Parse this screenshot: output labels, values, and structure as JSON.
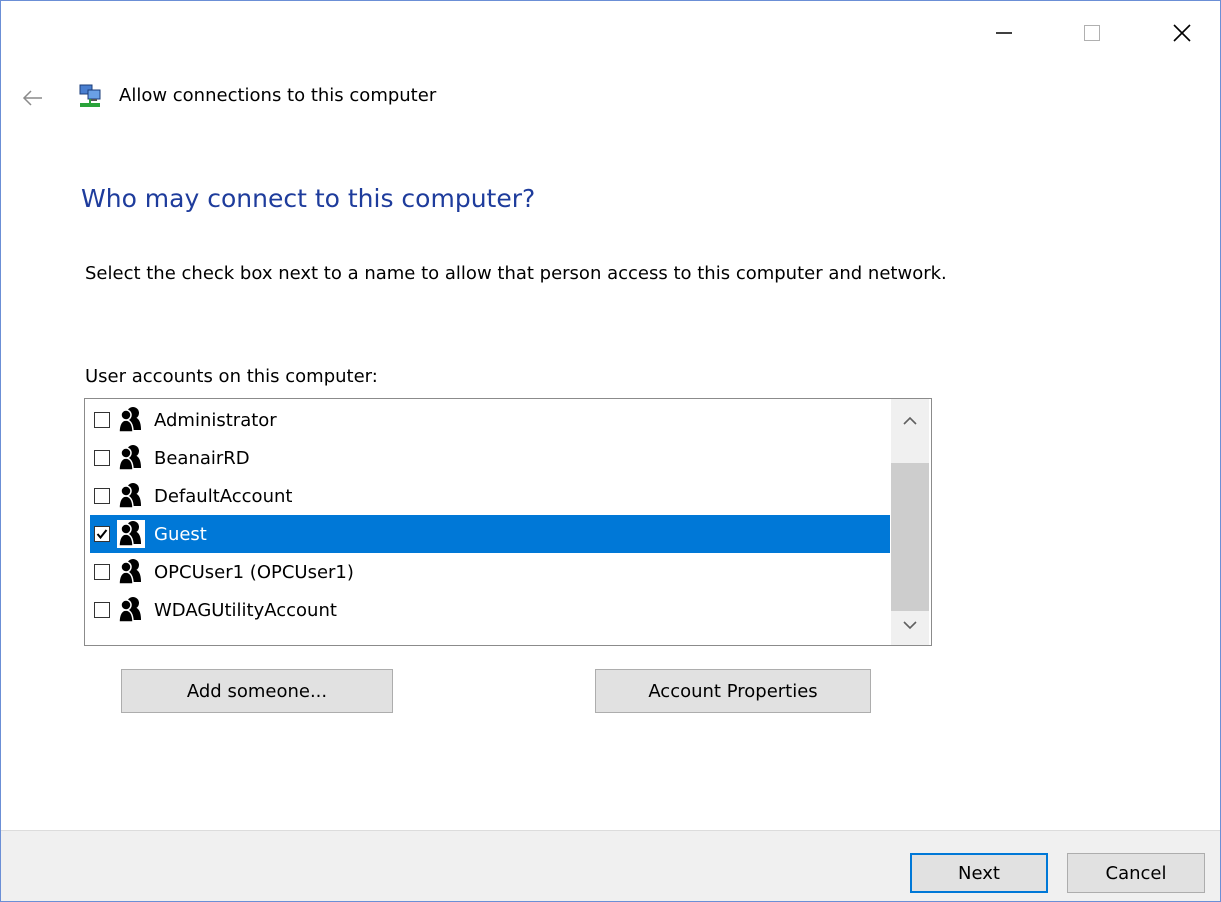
{
  "window": {
    "title": "Allow connections to this computer",
    "controls": [
      "minimize-icon",
      "maximize-icon",
      "close-icon"
    ]
  },
  "icons": {
    "back": "back-arrow-icon",
    "app": "network-connections-icon",
    "user": "user-account-icon"
  },
  "heading": "Who may connect to this computer?",
  "description": "Select the check box next to a name to allow that person access to this computer and network.",
  "list": {
    "label": "User accounts on this computer:",
    "items": [
      {
        "label": "Administrator",
        "checked": false,
        "selected": false
      },
      {
        "label": "BeanairRD",
        "checked": false,
        "selected": false
      },
      {
        "label": "DefaultAccount",
        "checked": false,
        "selected": false
      },
      {
        "label": "Guest",
        "checked": true,
        "selected": true
      },
      {
        "label": "OPCUser1 (OPCUser1)",
        "checked": false,
        "selected": false
      },
      {
        "label": "WDAGUtilityAccount",
        "checked": false,
        "selected": false
      }
    ]
  },
  "buttons": {
    "add": "Add someone...",
    "properties": "Account Properties",
    "next": "Next",
    "cancel": "Cancel"
  },
  "colors": {
    "heading": "#1e3c9c",
    "selection": "#0078d7",
    "default_button_border": "#0078d7"
  }
}
